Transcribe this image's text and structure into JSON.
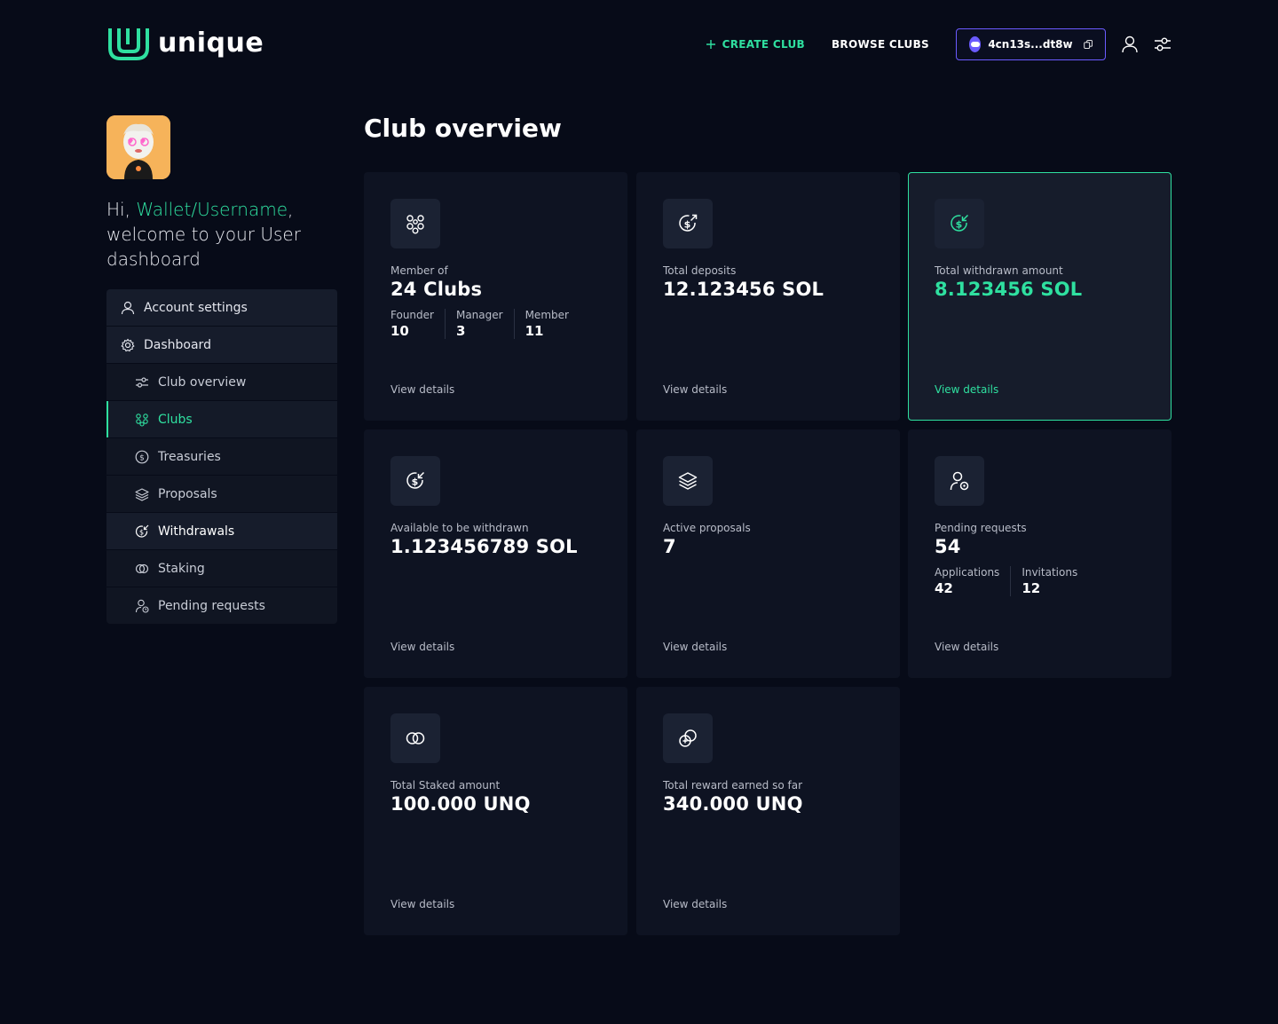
{
  "header": {
    "logo_text": "unique",
    "create_club": "CREATE CLUB",
    "browse_clubs": "BROWSE CLUBS",
    "wallet_address": "4cn13s...dt8w"
  },
  "sidebar": {
    "greeting_prefix": "Hi, ",
    "username": "Wallet/Username",
    "greeting_suffix": ", welcome to your User dashboard",
    "items": [
      {
        "label": "Account settings",
        "icon": "user-icon"
      },
      {
        "label": "Dashboard",
        "icon": "gear-icon"
      },
      {
        "label": "Club overview",
        "icon": "sliders-icon"
      },
      {
        "label": "Clubs",
        "icon": "clubs-icon",
        "active": true
      },
      {
        "label": "Treasuries",
        "icon": "dollar-circle-icon"
      },
      {
        "label": "Proposals",
        "icon": "layers-icon"
      },
      {
        "label": "Withdrawals",
        "icon": "withdraw-icon"
      },
      {
        "label": "Staking",
        "icon": "staking-icon"
      },
      {
        "label": "Pending requests",
        "icon": "user-pending-icon"
      }
    ]
  },
  "main": {
    "title": "Club overview",
    "view_details": "View details",
    "cards": [
      {
        "icon": "clubs-icon",
        "label": "Member of",
        "value": "24 Clubs",
        "subs": [
          {
            "label": "Founder",
            "value": "10"
          },
          {
            "label": "Manager",
            "value": "3"
          },
          {
            "label": "Member",
            "value": "11"
          }
        ]
      },
      {
        "icon": "deposit-icon",
        "label": "Total deposits",
        "value": "12.123456 SOL"
      },
      {
        "icon": "withdraw-icon",
        "label": "Total withdrawn amount",
        "value": "8.123456 SOL",
        "highlight": true
      },
      {
        "icon": "withdraw-icon",
        "label": "Available to be withdrawn",
        "value": "1.123456789 SOL"
      },
      {
        "icon": "layers-icon",
        "label": "Active proposals",
        "value": "7"
      },
      {
        "icon": "user-pending-icon",
        "label": "Pending requests",
        "value": "54",
        "subs": [
          {
            "label": "Applications",
            "value": "42"
          },
          {
            "label": "Invitations",
            "value": "12"
          }
        ]
      },
      {
        "icon": "staking-icon",
        "label": "Total Staked amount",
        "value": "100.000 UNQ"
      },
      {
        "icon": "reward-icon",
        "label": "Total reward earned so far",
        "value": "340.000 UNQ"
      }
    ]
  },
  "colors": {
    "background": "#070b18",
    "accent": "#2fe0a0",
    "wallet_border": "#6b5bff",
    "card": "#0e1322"
  }
}
